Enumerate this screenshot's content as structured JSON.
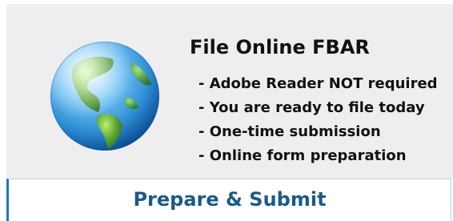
{
  "card": {
    "title": "File Online FBAR",
    "features": [
      "- Adobe Reader NOT required",
      "- You are ready to file today",
      "- One-time submission",
      "- Online form preparation"
    ],
    "icon": "globe-icon"
  },
  "action": {
    "label": "Prepare & Submit"
  },
  "colors": {
    "card_background": "#eeeeee",
    "title_text": "#111111",
    "button_text": "#1a5a8a",
    "button_accent": "#1f78b4",
    "ocean": "#2f8fd6",
    "land": "#5aa632"
  }
}
